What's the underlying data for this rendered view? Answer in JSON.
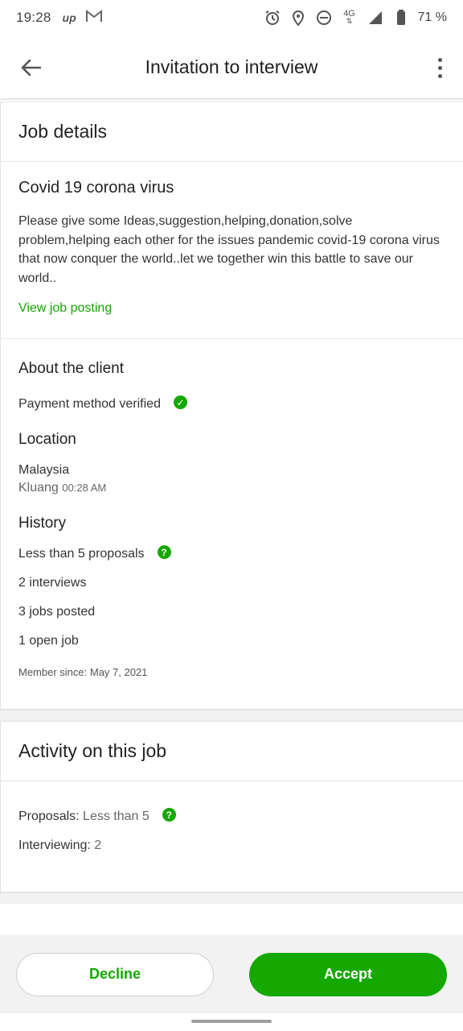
{
  "status_bar": {
    "time": "19:28",
    "battery": "71 %",
    "network": "4G"
  },
  "app_bar": {
    "title": "Invitation to interview"
  },
  "job_details": {
    "header": "Job details",
    "title": "Covid 19 corona virus",
    "description": "Please give some Ideas,suggestion,helping,donation,solve problem,helping each other for the issues pandemic covid-19 corona virus that now conquer the world..let we together win this battle to save our world..",
    "link": "View job posting"
  },
  "client": {
    "header": "About the client",
    "payment": "Payment method verified",
    "location_header": "Location",
    "country": "Malaysia",
    "city": "Kluang",
    "local_time": "00:28 AM",
    "history_header": "History",
    "proposals": "Less than 5 proposals",
    "interviews": "2 interviews",
    "jobs_posted": "3 jobs posted",
    "open_jobs": "1 open job",
    "member_since": "Member since: May 7, 2021"
  },
  "activity": {
    "header": "Activity on this job",
    "proposals_label": "Proposals:",
    "proposals_value": "Less than 5",
    "interviewing_label": "Interviewing:",
    "interviewing_value": "2"
  },
  "actions": {
    "decline": "Decline",
    "accept": "Accept"
  },
  "colors": {
    "accent": "#14a800"
  }
}
